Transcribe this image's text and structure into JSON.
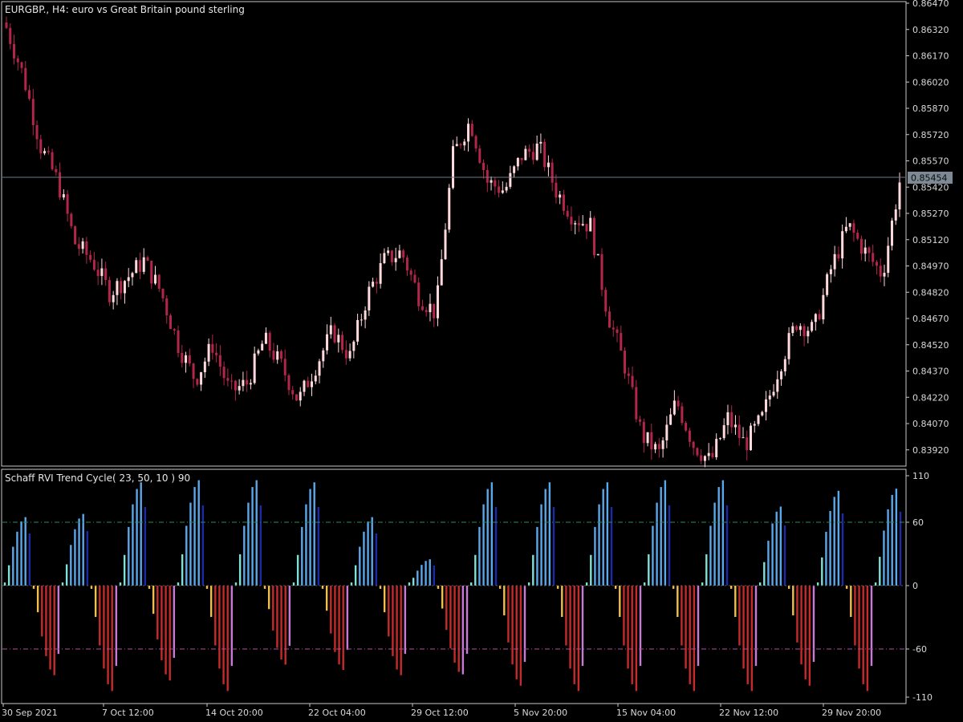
{
  "chart": {
    "symbol_title": "EURGBP., H4:  euro vs Great Britain pound sterling",
    "current_price_label": "0.85454",
    "current_price": 0.85454,
    "indicator_title": "Schaff RVI Trend Cycle( 23, 50, 10 ) 90",
    "price_axis_labels": [
      "0.86470",
      "0.86320",
      "0.86170",
      "0.86020",
      "0.85870",
      "0.85720",
      "0.85570",
      "0.85420",
      "0.85270",
      "0.85120",
      "0.84970",
      "0.84820",
      "0.84670",
      "0.84520",
      "0.84370",
      "0.84220",
      "0.84070",
      "0.83920"
    ],
    "indicator_axis_labels": [
      "110",
      "60",
      "0",
      "-60",
      "-110"
    ],
    "time_axis_labels": [
      "30 Sep 2021",
      "7 Oct 12:00",
      "14 Oct 20:00",
      "22 Oct 04:00",
      "29 Oct 12:00",
      "5 Nov 20:00",
      "15 Nov 04:00",
      "22 Nov 12:00",
      "29 Nov 20:00"
    ],
    "colors": {
      "background": "#000000",
      "axis": "#c8c8c8",
      "bull_candle": "#ffd9dc",
      "bear_candle": "#b3264a",
      "bull_candle_alt": "#3cb44b",
      "price_line": "#6c7a89",
      "level_up_line": "#2e8b57",
      "level_down_line": "#b44ba8",
      "hist_up_strong": "#5aa7ea",
      "hist_up_start": "#7fe0d6",
      "hist_up_weak": "#1c2aa6",
      "hist_down_strong": "#c62a2a",
      "hist_down_start": "#f2c04a",
      "hist_down_weak": "#c87ad6"
    }
  },
  "chart_data": [
    {
      "type": "candlestick",
      "title": "EURGBP., H4:  euro vs Great Britain pound sterling",
      "ylim": [
        0.8381,
        0.8647
      ],
      "x_start": "30 Sep 2021",
      "x_end": "1 Dec 2021",
      "close_path": [
        {
          "t": "30 Sep 2021",
          "price": 0.8633
        },
        {
          "t": "1 Oct 2021",
          "price": 0.8605
        },
        {
          "t": "2 Oct 2021",
          "price": 0.8565
        },
        {
          "t": "4 Oct 2021",
          "price": 0.8545
        },
        {
          "t": "5 Oct 2021",
          "price": 0.851
        },
        {
          "t": "6 Oct 2021",
          "price": 0.85
        },
        {
          "t": "7 Oct 12:00",
          "price": 0.8482
        },
        {
          "t": "9 Oct 2021",
          "price": 0.849
        },
        {
          "t": "11 Oct 2021",
          "price": 0.85
        },
        {
          "t": "12 Oct 2021",
          "price": 0.8482
        },
        {
          "t": "13 Oct 2021",
          "price": 0.8452
        },
        {
          "t": "14 Oct 20:00",
          "price": 0.8432
        },
        {
          "t": "15 Oct 2021",
          "price": 0.8452
        },
        {
          "t": "16 Oct 2021",
          "price": 0.8425
        },
        {
          "t": "18 Oct 2021",
          "price": 0.843
        },
        {
          "t": "20 Oct 2021",
          "price": 0.8455
        },
        {
          "t": "21 Oct 2021",
          "price": 0.844
        },
        {
          "t": "22 Oct 04:00",
          "price": 0.842
        },
        {
          "t": "23 Oct 2021",
          "price": 0.844
        },
        {
          "t": "25 Oct 2021",
          "price": 0.846
        },
        {
          "t": "26 Oct 2021",
          "price": 0.8445
        },
        {
          "t": "27 Oct 2021",
          "price": 0.848
        },
        {
          "t": "28 Oct 2021",
          "price": 0.85
        },
        {
          "t": "29 Oct 12:00",
          "price": 0.8505
        },
        {
          "t": "31 Oct 2021",
          "price": 0.848
        },
        {
          "t": "2 Nov 2021",
          "price": 0.847
        },
        {
          "t": "3 Nov 2021",
          "price": 0.856
        },
        {
          "t": "4 Nov 2021",
          "price": 0.858
        },
        {
          "t": "5 Nov 20:00",
          "price": 0.8545
        },
        {
          "t": "7 Nov 2021",
          "price": 0.854
        },
        {
          "t": "9 Nov 2021",
          "price": 0.856
        },
        {
          "t": "10 Nov 2021",
          "price": 0.8565
        },
        {
          "t": "11 Nov 2021",
          "price": 0.854
        },
        {
          "t": "12 Nov 2021",
          "price": 0.8525
        },
        {
          "t": "13 Nov 2021",
          "price": 0.852
        },
        {
          "t": "14 Nov 2021",
          "price": 0.847
        },
        {
          "t": "15 Nov 04:00",
          "price": 0.844
        },
        {
          "t": "16 Nov 2021",
          "price": 0.84
        },
        {
          "t": "17 Nov 2021",
          "price": 0.839
        },
        {
          "t": "18 Nov 2021",
          "price": 0.842
        },
        {
          "t": "20 Nov 2021",
          "price": 0.8395
        },
        {
          "t": "21 Nov 2021",
          "price": 0.8385
        },
        {
          "t": "22 Nov 12:00",
          "price": 0.841
        },
        {
          "t": "23 Nov 2021",
          "price": 0.8395
        },
        {
          "t": "24 Nov 2021",
          "price": 0.841
        },
        {
          "t": "25 Nov 2021",
          "price": 0.844
        },
        {
          "t": "26 Nov 2021",
          "price": 0.8465
        },
        {
          "t": "27 Nov 2021",
          "price": 0.846
        },
        {
          "t": "28 Nov 2021",
          "price": 0.8495
        },
        {
          "t": "29 Nov 20:00",
          "price": 0.852
        },
        {
          "t": "30 Nov 2021",
          "price": 0.8505
        },
        {
          "t": "1 Dec 2021",
          "price": 0.8492
        },
        {
          "t": "1 Dec 2021",
          "price": 0.8545
        }
      ],
      "bar_count": 235,
      "last_price": 0.85454
    },
    {
      "type": "bar",
      "title": "Schaff RVI Trend Cycle( 23, 50, 10 ) 90",
      "ylim": [
        -110,
        110
      ],
      "levels": [
        60,
        0,
        -60
      ],
      "segments": [
        {
          "sign": 1,
          "peak": 65
        },
        {
          "sign": -1,
          "peak": 85
        },
        {
          "sign": 1,
          "peak": 68
        },
        {
          "sign": -1,
          "peak": 100
        },
        {
          "sign": 1,
          "peak": 98
        },
        {
          "sign": -1,
          "peak": 90
        },
        {
          "sign": 1,
          "peak": 100
        },
        {
          "sign": -1,
          "peak": 100
        },
        {
          "sign": 1,
          "peak": 100
        },
        {
          "sign": -1,
          "peak": 75
        },
        {
          "sign": 1,
          "peak": 98
        },
        {
          "sign": -1,
          "peak": 80
        },
        {
          "sign": 1,
          "peak": 65
        },
        {
          "sign": -1,
          "peak": 85
        },
        {
          "sign": 1,
          "peak": 25
        },
        {
          "sign": -1,
          "peak": 85
        },
        {
          "sign": 1,
          "peak": 98
        },
        {
          "sign": -1,
          "peak": 95
        },
        {
          "sign": 1,
          "peak": 98
        },
        {
          "sign": -1,
          "peak": 100
        },
        {
          "sign": 1,
          "peak": 98
        },
        {
          "sign": -1,
          "peak": 100
        },
        {
          "sign": 1,
          "peak": 100
        },
        {
          "sign": -1,
          "peak": 100
        },
        {
          "sign": 1,
          "peak": 100
        },
        {
          "sign": -1,
          "peak": 100
        },
        {
          "sign": 1,
          "peak": 75
        },
        {
          "sign": -1,
          "peak": 95
        },
        {
          "sign": 1,
          "peak": 90
        },
        {
          "sign": -1,
          "peak": 100
        },
        {
          "sign": 1,
          "peak": 92
        }
      ]
    }
  ]
}
